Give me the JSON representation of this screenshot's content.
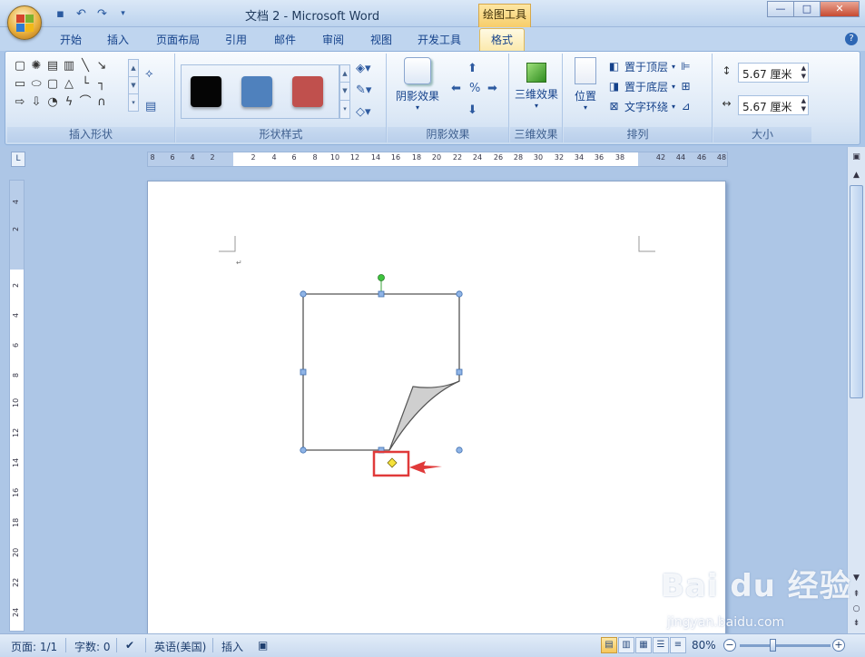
{
  "window": {
    "title": "文档 2 - Microsoft Word",
    "context_tab": "绘图工具",
    "controls": [
      "—",
      "□",
      "✕"
    ]
  },
  "tabs": [
    "开始",
    "插入",
    "页面布局",
    "引用",
    "邮件",
    "审阅",
    "视图",
    "开发工具",
    "格式"
  ],
  "active_tab": "格式",
  "ribbon": {
    "groups": {
      "insert_shapes": "插入形状",
      "shape_styles": "形状样式",
      "shadow_effects": "阴影效果",
      "three_d": "三维效果",
      "arrange": "排列",
      "size": "大小"
    },
    "swatch_colors": [
      "#050505",
      "#4f81bd",
      "#c0504d"
    ],
    "shadow_button": "阴影效果",
    "three_d_button": "三维效果",
    "position_button": "位置",
    "bring_front": "置于顶层",
    "send_back": "置于底层",
    "text_wrap": "文字环绕",
    "height_value": "5.67 厘米",
    "width_value": "5.67 厘米"
  },
  "ruler": {
    "h_ticks": [
      "8",
      "6",
      "4",
      "2",
      "2",
      "4",
      "6",
      "8",
      "10",
      "12",
      "14",
      "16",
      "18",
      "20",
      "22",
      "24",
      "26",
      "28",
      "30",
      "32",
      "34",
      "36",
      "38",
      "42",
      "44",
      "46",
      "48"
    ],
    "v_ticks": [
      "4",
      "2",
      "2",
      "4",
      "6",
      "8",
      "10",
      "12",
      "14",
      "16",
      "18",
      "20",
      "22",
      "24"
    ],
    "corner": "L"
  },
  "statusbar": {
    "page": "页面: 1/1",
    "words": "字数: 0",
    "language": "英语(美国)",
    "mode": "插入",
    "zoom": "80%"
  },
  "watermark": {
    "brand": "Bai du 经验",
    "url": "jingyan.baidu.com"
  },
  "highlight_color": "#e03a3a"
}
